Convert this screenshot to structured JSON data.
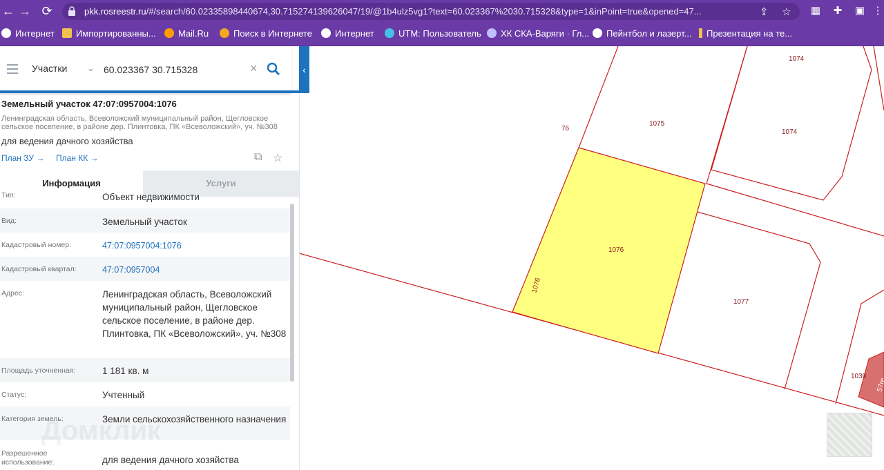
{
  "browser": {
    "url_domain": "pkk.rosreestr.ru",
    "url_rest": "/#/search/60.02335898440674,30.71527413962604​7/19/@1b4ulz5vg1?text=60.023367%2030.715328&type=1&inPoint=true&opened=47...",
    "accent": "#6a3ba6"
  },
  "bookmarks": [
    {
      "label": "Интернет",
      "icon": "globe-icon",
      "color": "#ffffff"
    },
    {
      "label": "Импортированны...",
      "icon": "folder-icon",
      "color": "#f2c14e"
    },
    {
      "label": "Mail.Ru",
      "icon": "at-icon",
      "color": "#ff9d00"
    },
    {
      "label": "Поиск в Интернете",
      "icon": "search-engine-icon",
      "color": "#f5a623"
    },
    {
      "label": "Интернет",
      "icon": "globe-icon",
      "color": "#ffffff"
    },
    {
      "label": "UTM: Пользователь",
      "icon": "utm-icon",
      "color": "#46c0e8"
    },
    {
      "label": "ХК СКА-Варяги · Гл...",
      "icon": "hockey-icon",
      "color": "#c0c0ff"
    },
    {
      "label": "Пейнтбол и лазерт...",
      "icon": "globe-icon",
      "color": "#ffffff"
    },
    {
      "label": "Презентация на те...",
      "icon": "presentation-icon",
      "color": "#f2c14e"
    }
  ],
  "search": {
    "type_label": "Участки",
    "value": "60.023367 30.715328"
  },
  "object": {
    "title": "Земельный участок 47:07:0957004:1076",
    "address_short": "Ленинградская область, Всеволожский муниципальный район, Щегловское сельское поселение, в районе дер. Плинтовка, ПК «Всеволожский», уч. №308",
    "use": "для ведения дачного хозяйства",
    "plan_zu": "План ЗУ →",
    "plan_kk": "План КК →"
  },
  "tabs": {
    "info": "Информация",
    "services": "Услуги"
  },
  "properties": [
    {
      "label": "Тип:",
      "value": "Объект недвижимости"
    },
    {
      "label": "Вид:",
      "value": "Земельный участок"
    },
    {
      "label": "Кадастровый номер:",
      "value": "47:07:0957004:1076"
    },
    {
      "label": "Кадастровый квартал:",
      "value": "47:07:0957004"
    },
    {
      "label": "Адрес:",
      "value": "Ленинградская область, Всеволожский муниципальный район, Щегловское сельское поселение, в районе дер. Плинтовка, ПК «Всеволожский», уч. №308"
    },
    {
      "label": "Площадь уточненная:",
      "value": "1 181 кв. м"
    },
    {
      "label": "Статус:",
      "value": "Учтенный"
    },
    {
      "label": "Категория земель:",
      "value": "Земли сельскохозяйственного назначения"
    },
    {
      "label": "Разрешенное использование:",
      "value": "для ведения дачного хозяйства"
    }
  ],
  "watermark": "Домклик",
  "map": {
    "parcel_color": "#ffff80",
    "line_color": "#cc1f1f",
    "labels": {
      "p1074a": "1074",
      "p1074b": "1074",
      "p1075": "1075",
      "p76": "76",
      "p1076": "1076",
      "p1076side": "1076",
      "p1077": "1077",
      "p1039": "1039",
      "pcut": "57re"
    }
  }
}
